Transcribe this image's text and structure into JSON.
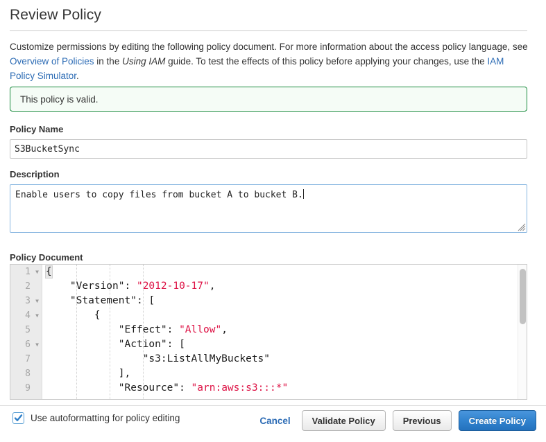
{
  "page": {
    "title": "Review Policy",
    "intro": {
      "part1": "Customize permissions by editing the following policy document. For more information about the access policy language, see ",
      "link1": "Overview of Policies",
      "part2": " in the ",
      "italic": "Using IAM",
      "part3": " guide. To test the effects of this policy before applying your changes, use the ",
      "link2": "IAM Policy Simulator",
      "part4": "."
    }
  },
  "banner": {
    "message": "This policy is valid.",
    "border_color": "#178a3c",
    "background_color": "#f5fcf6"
  },
  "fields": {
    "policy_name": {
      "label": "Policy Name",
      "value": "S3BucketSync",
      "placeholder": ""
    },
    "description": {
      "label": "Description",
      "value": "Enable users to copy files from bucket A to bucket B.",
      "placeholder": ""
    },
    "policy_document": {
      "label": "Policy Document"
    }
  },
  "editor": {
    "lines": [
      {
        "number": "1",
        "foldable": true,
        "indent": 0
      },
      {
        "number": "2",
        "foldable": false,
        "indent": 1
      },
      {
        "number": "3",
        "foldable": true,
        "indent": 1
      },
      {
        "number": "4",
        "foldable": true,
        "indent": 2
      },
      {
        "number": "5",
        "foldable": false,
        "indent": 3
      },
      {
        "number": "6",
        "foldable": true,
        "indent": 3
      },
      {
        "number": "7",
        "foldable": false,
        "indent": 4
      },
      {
        "number": "8",
        "foldable": false,
        "indent": 3
      },
      {
        "number": "9",
        "foldable": false,
        "indent": 3
      }
    ],
    "code_text": [
      "{",
      "    \"Version\": \"2012-10-17\",",
      "    \"Statement\": [",
      "        {",
      "            \"Effect\": \"Allow\",",
      "            \"Action\": [",
      "                \"s3:ListAllMyBuckets\"",
      "            ],",
      "            \"Resource\": \"arn:aws:s3:::*\""
    ],
    "string_color": "#dd1144",
    "gutter_background": "#ebebeb",
    "scroll_position": "top"
  },
  "footer": {
    "autoformat": {
      "label": "Use autoformatting for policy editing",
      "checked": true
    },
    "cancel_label": "Cancel",
    "validate_label": "Validate Policy",
    "previous_label": "Previous",
    "create_label": "Create Policy",
    "primary_color": "#3183cf"
  }
}
